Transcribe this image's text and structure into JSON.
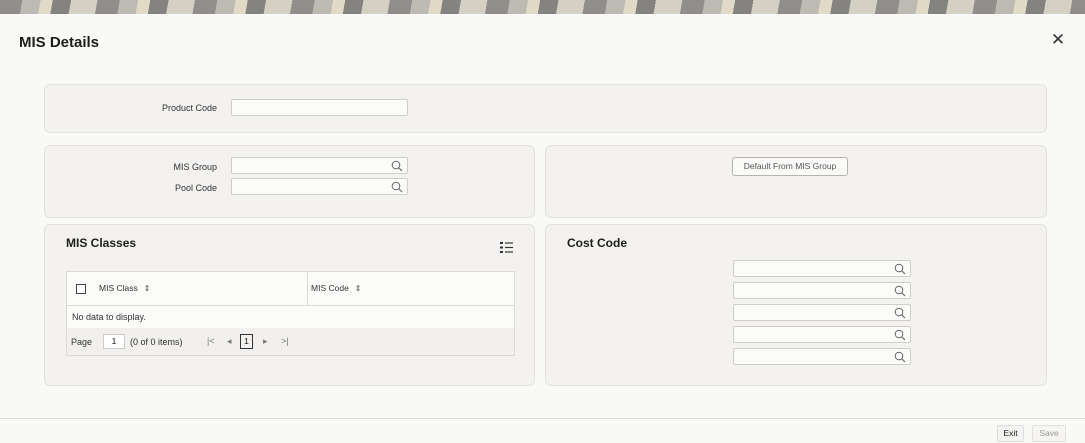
{
  "dialog": {
    "title": "MIS Details",
    "close_icon": "close-icon"
  },
  "product": {
    "product_code_label": "Product Code",
    "product_code_value": ""
  },
  "group": {
    "mis_group_label": "MIS Group",
    "mis_group_value": "",
    "pool_code_label": "Pool Code",
    "pool_code_value": "",
    "default_button": "Default From MIS Group"
  },
  "mis_classes": {
    "title": "MIS Classes",
    "columns": [
      "MIS Class",
      "MIS Code"
    ],
    "empty_text": "No data to display.",
    "pager": {
      "page_label": "Page",
      "page_value": "1",
      "items_text": "(0 of 0 items)",
      "current_page": "1"
    }
  },
  "cost_code": {
    "title": "Cost Code",
    "fields": [
      "",
      "",
      "",
      "",
      ""
    ]
  },
  "footer": {
    "exit_label": "Exit",
    "save_label": "Save"
  },
  "colors": {
    "panel_bg": "#f3f2f1",
    "border": "#e4e2df",
    "text": "#161513"
  }
}
